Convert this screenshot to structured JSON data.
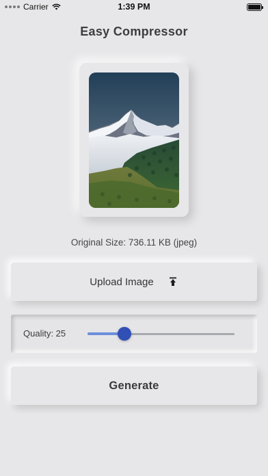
{
  "status_bar": {
    "carrier": "Carrier",
    "time": "1:39 PM",
    "icons": [
      "signal-dots-icon",
      "wifi-icon",
      "battery-icon"
    ]
  },
  "header": {
    "title": "Easy Compressor"
  },
  "image_preview": {
    "subject": "snowy mountain peak above clouds and forested valley"
  },
  "info": {
    "original_size": "Original Size: 736.11 KB (jpeg)"
  },
  "upload": {
    "label": "Upload Image",
    "icon": "upload-icon"
  },
  "quality": {
    "label": "Quality: 25",
    "value": 25,
    "min": 0,
    "max": 100
  },
  "generate": {
    "label": "Generate"
  },
  "colors": {
    "background": "#e7e7e9",
    "slider_thumb": "#3050b6",
    "slider_active": "#6d8fdc",
    "slider_inactive": "#a7a9ad"
  }
}
